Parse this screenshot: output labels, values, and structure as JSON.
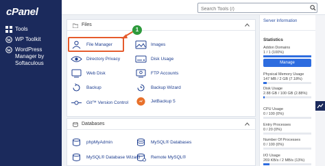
{
  "brand": {
    "logo_text": "cPanel"
  },
  "sidebar": {
    "items": [
      {
        "label": "Tools",
        "icon": "grid-icon"
      },
      {
        "label": "WP Toolkit",
        "icon": "wordpress-icon"
      },
      {
        "label": "WordPress Manager by Softaculous",
        "icon": "wordpress-icon"
      }
    ]
  },
  "header": {
    "search_placeholder": "Search Tools (/)"
  },
  "files_section": {
    "title": "Files",
    "tools": [
      {
        "label": "File Manager",
        "icon": "user-folder-icon"
      },
      {
        "label": "Images",
        "icon": "image-icon"
      },
      {
        "label": "Directory Privacy",
        "icon": "eye-icon"
      },
      {
        "label": "Disk Usage",
        "icon": "disk-icon"
      },
      {
        "label": "Web Disk",
        "icon": "web-disk-icon"
      },
      {
        "label": "FTP Accounts",
        "icon": "ftp-accounts-icon"
      },
      {
        "label": "Backup",
        "icon": "backup-icon"
      },
      {
        "label": "Backup Wizard",
        "icon": "backup-wizard-icon"
      },
      {
        "label": "Git™ Version Control",
        "icon": "git-icon"
      },
      {
        "label": "JetBackup 5",
        "icon": "jetbackup-icon"
      }
    ]
  },
  "databases_section": {
    "title": "Databases",
    "tools": [
      {
        "label": "phpMyAdmin",
        "icon": "phpmyadmin-icon"
      },
      {
        "label": "MySQL® Databases",
        "icon": "mysql-databases-icon"
      },
      {
        "label": "MySQL® Database Wizard",
        "icon": "mysql-wizard-icon"
      },
      {
        "label": "Remote MySQL®",
        "icon": "remote-mysql-icon"
      }
    ]
  },
  "annotation": {
    "step_number": "1"
  },
  "right_panel": {
    "server_info_link": "Server Information",
    "statistics_title": "Statistics",
    "manage_label": "Manage",
    "stats": [
      {
        "label": "Addon Domains",
        "value": "1 / 1 (100%)",
        "fraction": 1.0
      },
      {
        "label": "Physical Memory Usage",
        "value": "147 MB / 2 GB (7.18%)",
        "fraction": 0.0718
      },
      {
        "label": "Disk Usage",
        "value": "2.88 GB / 100 GB (2.88%)",
        "fraction": 0.0288
      },
      {
        "label": "CPU Usage",
        "value": "0 / 100 (0%)",
        "fraction": 0.0
      },
      {
        "label": "Entry Processes",
        "value": "0 / 20 (0%)",
        "fraction": 0.0
      },
      {
        "label": "Number Of Processes",
        "value": "0 / 100 (0%)",
        "fraction": 0.0
      },
      {
        "label": "I/O Usage",
        "value": "269 KB/s / 2 MB/s (13%)",
        "fraction": 0.13
      }
    ]
  },
  "colors": {
    "sidebar_bg": "#1b2a5c",
    "accent_blue": "#2d6cdf",
    "highlight_orange": "#e55a2b",
    "badge_green": "#2e9a3c"
  }
}
